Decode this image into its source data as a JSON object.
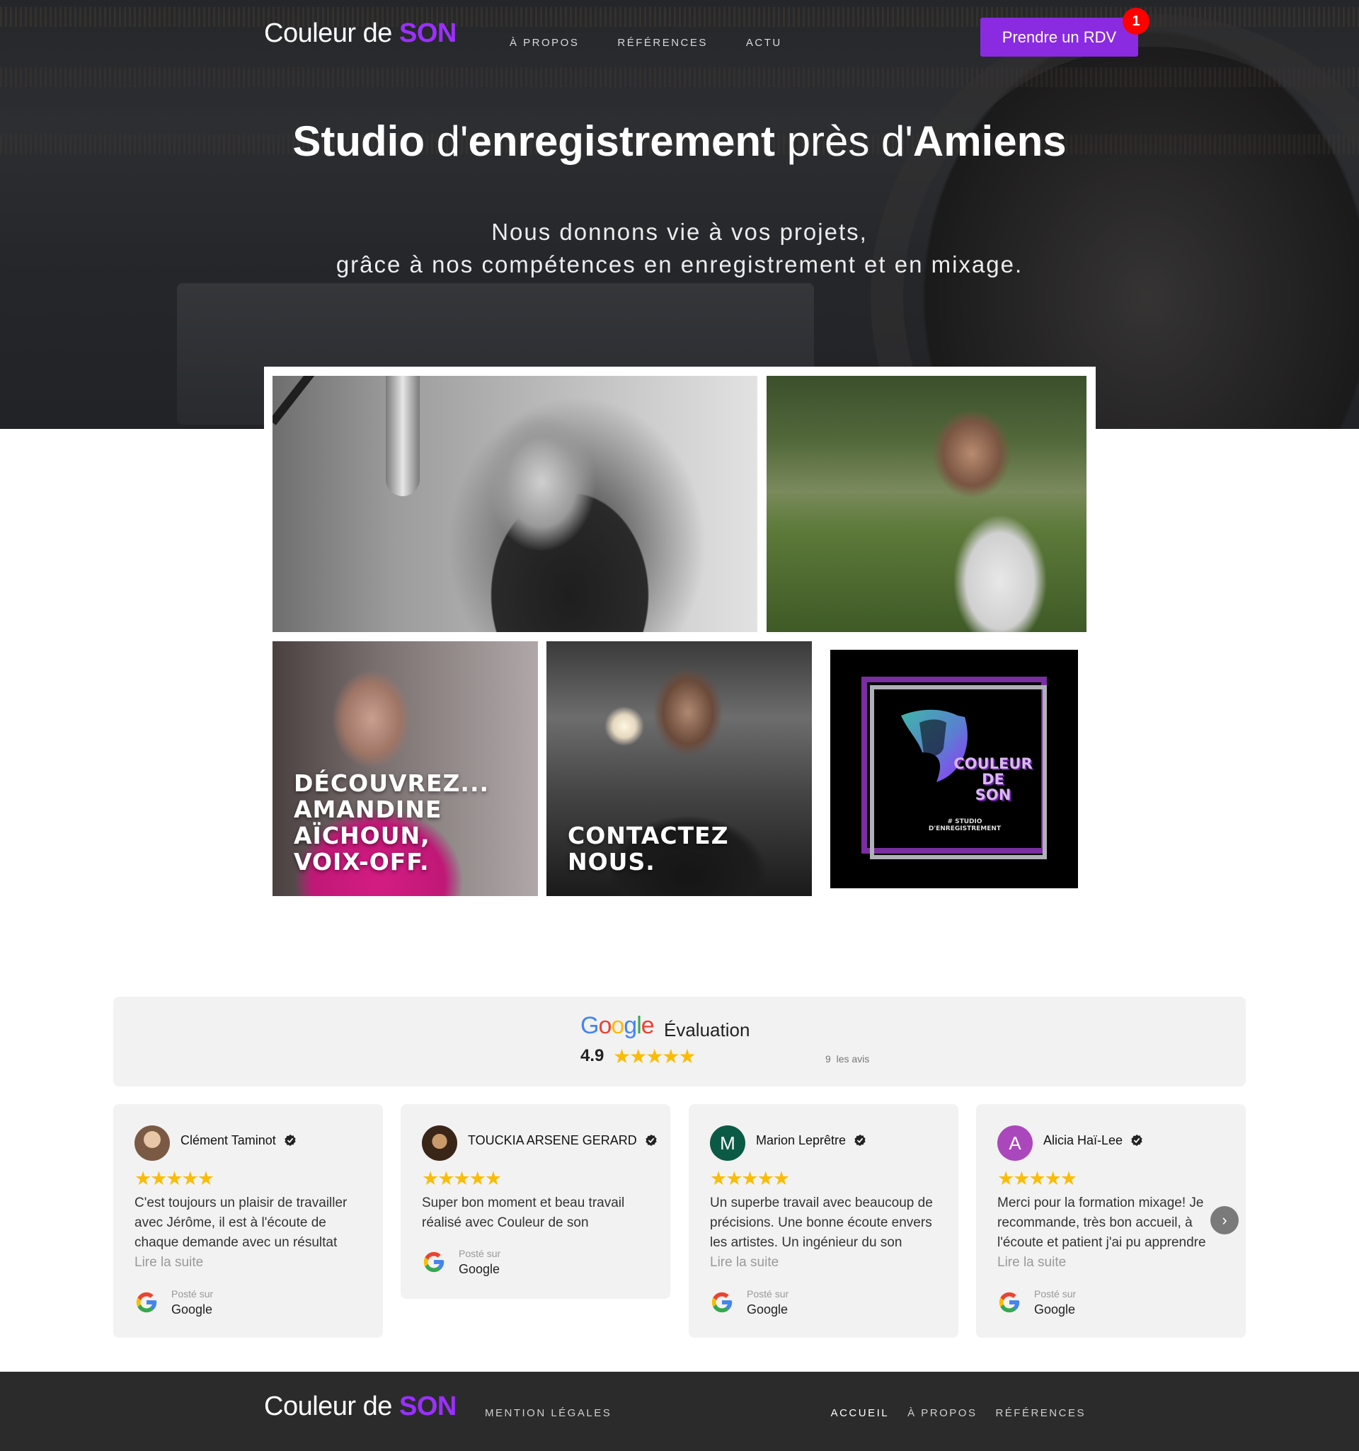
{
  "header": {
    "logo_main": "Couleur de",
    "logo_accent": "SON",
    "nav": [
      "À PROPOS",
      "RÉFÉRENCES",
      "ACTU"
    ],
    "cta_label": "Prendre un RDV",
    "cta_badge": "1"
  },
  "hero": {
    "title_w1": "Studio",
    "title_w2": "d'",
    "title_w3": "enregistrement",
    "title_w4": "près d'",
    "title_w5": "Amiens",
    "subtitle_line1": "Nous donnons vie à vos projets,",
    "subtitle_line2": "grâce à nos compétences en enregistrement et en mixage."
  },
  "gallery": {
    "tile_voiceover": "DÉCOUVREZ... AMANDINE AÏCHOUN, VOIX-OFF.",
    "tile_contact": "CONTACTEZ NOUS.",
    "logo_brand_line1": "COULEUR",
    "logo_brand_line2": "DE",
    "logo_brand_line3": "SON",
    "logo_tag_line1": "# STUDIO",
    "logo_tag_line2": "D'ENREGISTREMENT"
  },
  "rating": {
    "provider": "Google",
    "label": "Évaluation",
    "score": "4.9",
    "stars": 5,
    "count": "9",
    "count_label": "les avis"
  },
  "reviews": [
    {
      "author": "Clément Taminot",
      "avatar": "",
      "avatar_color": "#8a6a55",
      "stars": 5,
      "text": "C'est toujours un plaisir de travailler avec Jérôme, il est à l'écoute de chaque demande avec un résultat",
      "more": "Lire la suite",
      "posted_label": "Posté sur",
      "posted_on": "Google"
    },
    {
      "author": "TOUCKIA ARSENE GERARD",
      "avatar": "",
      "avatar_color": "#5a3a25",
      "stars": 5,
      "text": "Super bon moment et beau travail réalisé avec Couleur de son",
      "more": "",
      "posted_label": "Posté sur",
      "posted_on": "Google"
    },
    {
      "author": "Marion Leprêtre",
      "avatar": "M",
      "avatar_color": "#0b5a45",
      "stars": 5,
      "text": "Un superbe travail avec beaucoup de précisions. Une bonne écoute envers les artistes. Un ingénieur du son",
      "more": "Lire la suite",
      "posted_label": "Posté sur",
      "posted_on": "Google"
    },
    {
      "author": "Alicia Haï-Lee",
      "avatar": "A",
      "avatar_color": "#ab47bc",
      "stars": 5,
      "text": "Merci pour la formation mixage! Je recommande, très bon accueil, à l'écoute et patient j'ai pu apprendre",
      "more": "Lire la suite",
      "posted_label": "Posté sur",
      "posted_on": "Google"
    }
  ],
  "footer": {
    "logo_main": "Couleur de",
    "logo_accent": "SON",
    "legal": "MENTION LÉGALES",
    "nav": [
      "ACCUEIL",
      "À PROPOS",
      "RÉFÉRENCES"
    ]
  },
  "colors": {
    "accent": "#8a2be2",
    "badge": "#ff0000",
    "star": "#fbbc05",
    "footer_bg": "#2b2b2b"
  }
}
